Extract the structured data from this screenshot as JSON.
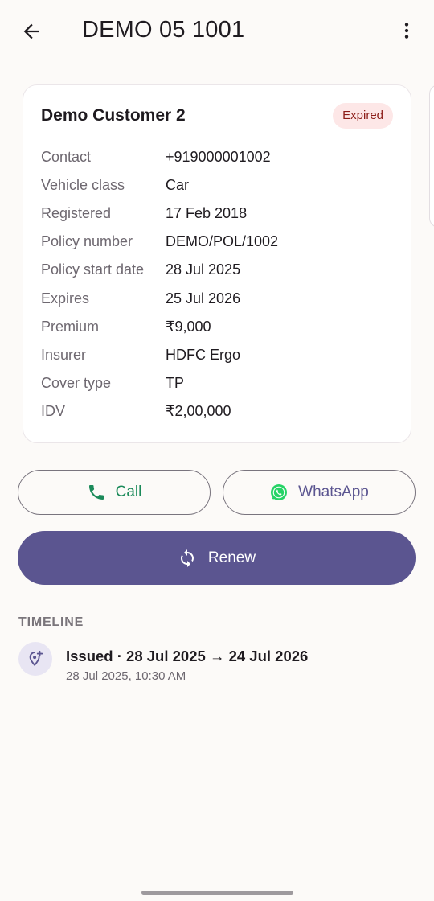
{
  "header": {
    "title": "DEMO 05 1001"
  },
  "card": {
    "customer_name": "Demo Customer 2",
    "status": "Expired",
    "rows": [
      {
        "label": "Contact",
        "value": "+919000001002"
      },
      {
        "label": "Vehicle class",
        "value": "Car"
      },
      {
        "label": "Registered",
        "value": "17 Feb 2018"
      },
      {
        "label": "Policy number",
        "value": "DEMO/POL/1002"
      },
      {
        "label": "Policy start date",
        "value": "28 Jul 2025"
      },
      {
        "label": "Expires",
        "value": "25 Jul 2026"
      },
      {
        "label": "Premium",
        "value": "₹9,000"
      },
      {
        "label": "Insurer",
        "value": "HDFC Ergo"
      },
      {
        "label": "Cover type",
        "value": "TP"
      },
      {
        "label": "IDV",
        "value": "₹2,00,000"
      }
    ]
  },
  "actions": {
    "call_label": "Call",
    "whatsapp_label": "WhatsApp",
    "renew_label": "Renew"
  },
  "timeline": {
    "title": "TIMELINE",
    "items": [
      {
        "text": "Issued · 28 Jul 2025 → 24 Jul 2026",
        "time": "28 Jul 2025, 10:30 AM"
      }
    ]
  },
  "icons": {
    "back": "arrow-left-icon",
    "menu": "more-vert-icon",
    "call": "phone-icon",
    "whatsapp": "whatsapp-icon",
    "renew": "refresh-icon",
    "timeline": "location-add-icon"
  },
  "colors": {
    "primary": "#5b5590",
    "call_green": "#1b8a5a",
    "expired_bg": "#fde7e7",
    "expired_text": "#8c1d18",
    "background": "#fcfaf8"
  }
}
